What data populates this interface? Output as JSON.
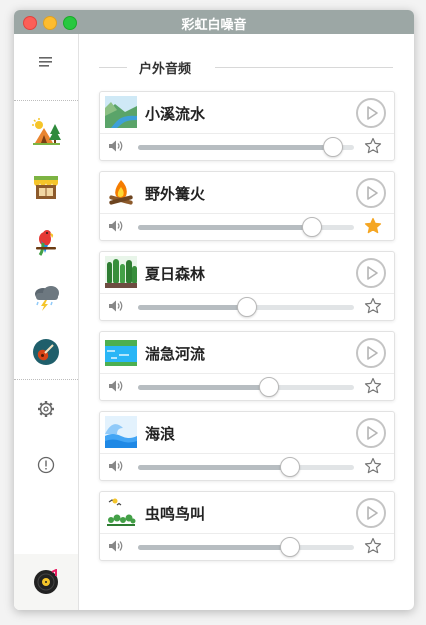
{
  "window": {
    "title": "彩虹白噪音"
  },
  "section": {
    "title": "户外音频"
  },
  "sidebar": {
    "items": [
      {
        "name": "menu-icon"
      },
      {
        "name": "camping-category-icon"
      },
      {
        "name": "shop-category-icon"
      },
      {
        "name": "parrot-category-icon"
      },
      {
        "name": "thunderstorm-category-icon"
      },
      {
        "name": "guitar-category-icon"
      },
      {
        "name": "settings-icon"
      },
      {
        "name": "info-icon"
      },
      {
        "name": "vinyl-record-icon"
      }
    ]
  },
  "sounds": [
    {
      "name": "小溪流水",
      "icon": "stream-icon",
      "volume": 0.9,
      "favorite": false
    },
    {
      "name": "野外篝火",
      "icon": "campfire-icon",
      "volume": 0.8,
      "favorite": true
    },
    {
      "name": "夏日森林",
      "icon": "forest-icon",
      "volume": 0.5,
      "favorite": false
    },
    {
      "name": "湍急河流",
      "icon": "river-icon",
      "volume": 0.6,
      "favorite": false
    },
    {
      "name": "海浪",
      "icon": "waves-icon",
      "volume": 0.7,
      "favorite": false
    },
    {
      "name": "虫鸣鸟叫",
      "icon": "birds-insects-icon",
      "volume": 0.7,
      "favorite": false
    }
  ],
  "colors": {
    "favorite": "#f5a623",
    "titlebar": "#9ca7a5"
  }
}
